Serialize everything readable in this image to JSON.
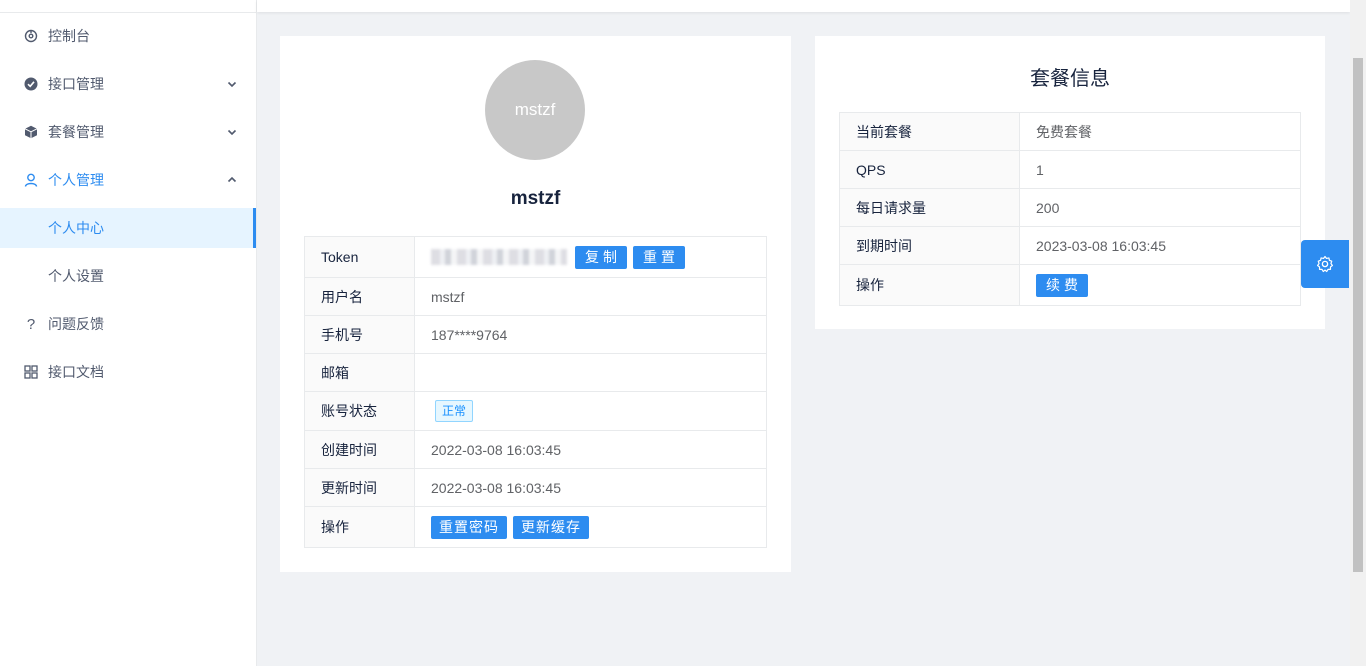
{
  "sidebar": {
    "items": [
      {
        "label": "控制台",
        "icon": "dashboard-icon"
      },
      {
        "label": "接口管理",
        "icon": "api-check-icon"
      },
      {
        "label": "套餐管理",
        "icon": "package-cube-icon"
      },
      {
        "label": "个人管理",
        "icon": "user-icon"
      },
      {
        "label": "个人中心"
      },
      {
        "label": "个人设置"
      },
      {
        "label": "问题反馈",
        "icon": "question-icon"
      },
      {
        "label": "接口文档",
        "icon": "grid-icon"
      }
    ]
  },
  "profile": {
    "avatar_text": "mstzf",
    "username": "mstzf",
    "rows": {
      "token_label": "Token",
      "copy_btn": "复制",
      "reset_btn": "重置",
      "username_label": "用户名",
      "username_value": "mstzf",
      "phone_label": "手机号",
      "phone_value": "187****9764",
      "email_label": "邮箱",
      "email_value": "",
      "status_label": "账号状态",
      "status_value": "正常",
      "created_label": "创建时间",
      "created_value": "2022-03-08 16:03:45",
      "updated_label": "更新时间",
      "updated_value": "2022-03-08 16:03:45",
      "action_label": "操作",
      "reset_password_btn": "重置密码",
      "refresh_cache_btn": "更新缓存"
    }
  },
  "package": {
    "title": "套餐信息",
    "current_label": "当前套餐",
    "current_value": "免费套餐",
    "qps_label": "QPS",
    "qps_value": "1",
    "daily_label": "每日请求量",
    "daily_value": "200",
    "expire_label": "到期时间",
    "expire_value": "2023-03-08 16:03:45",
    "action_label": "操作",
    "renew_btn": "续费"
  },
  "colors": {
    "primary": "#2d8cf0",
    "active_bg": "#e6f4ff",
    "page_bg": "#f0f2f5"
  },
  "floating": {
    "icon": "settings-gear-icon"
  }
}
